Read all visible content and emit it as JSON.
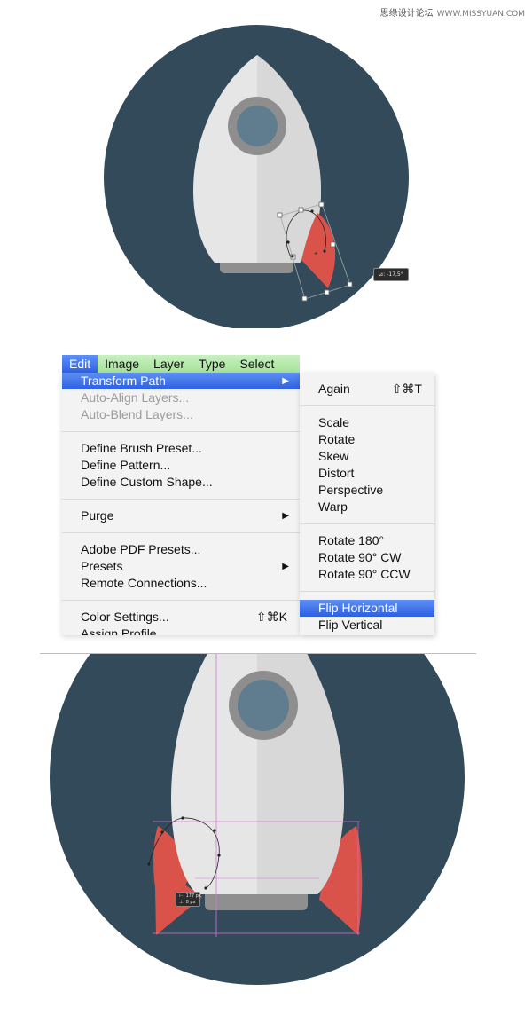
{
  "watermark": {
    "text": "思缘设计论坛",
    "url": "WWW.MISSYUAN.COM"
  },
  "top_canvas": {
    "rotate_readout": "⊿: -17,5°"
  },
  "menubar": {
    "items": [
      "Edit",
      "Image",
      "Layer",
      "Type",
      "Select"
    ]
  },
  "edit_menu": {
    "transform_path": "Transform Path",
    "auto_align": "Auto-Align Layers...",
    "auto_blend": "Auto-Blend Layers...",
    "define_brush": "Define Brush Preset...",
    "define_pattern": "Define Pattern...",
    "define_shape": "Define Custom Shape...",
    "purge": "Purge",
    "pdf_presets": "Adobe PDF Presets...",
    "presets": "Presets",
    "remote": "Remote Connections...",
    "color_settings": "Color Settings...",
    "color_settings_shortcut": "⇧⌘K",
    "assign_profile": "Assign Profile..."
  },
  "transform_submenu": {
    "again": "Again",
    "again_shortcut": "⇧⌘T",
    "scale": "Scale",
    "rotate": "Rotate",
    "skew": "Skew",
    "distort": "Distort",
    "perspective": "Perspective",
    "warp": "Warp",
    "rotate180": "Rotate 180°",
    "rotate90cw": "Rotate 90° CW",
    "rotate90ccw": "Rotate 90° CCW",
    "flip_h": "Flip Horizontal",
    "flip_v": "Flip Vertical"
  },
  "bottom_canvas": {
    "measure_w": "⊢: 177 px",
    "measure_h": "⊥: 0 px"
  },
  "colors": {
    "circle": "#324a5a",
    "rocket_light": "#e6e6e6",
    "rocket_shade": "#d6d6d6",
    "porthole_ring": "#8e8e8e",
    "porthole_glass": "#5f7d8e",
    "fin": "#d9534a",
    "menu_highlight": "#3a6cea",
    "menubar_green": "#b3e8a8"
  }
}
